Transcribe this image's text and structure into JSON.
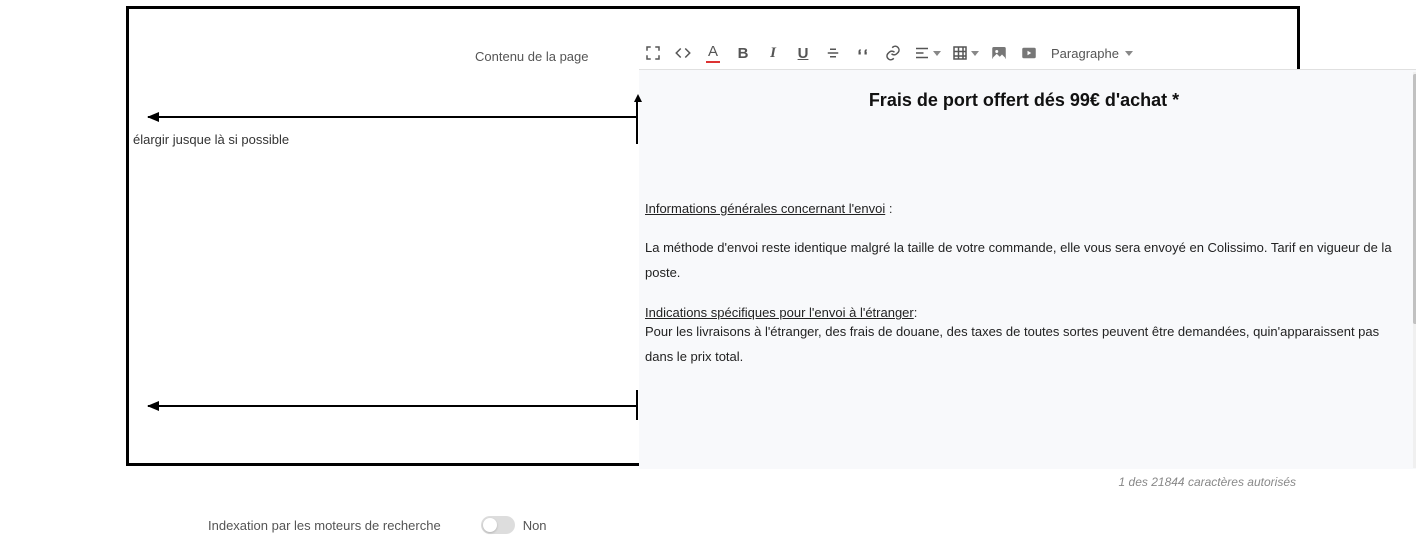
{
  "label": "Contenu de la page",
  "toolbar": {
    "paragraph_label": "Paragraphe"
  },
  "content": {
    "title": "Frais de port offert dés 99€ d'achat *",
    "section1_label": "Informations générales concernant l'envoi",
    "para1": "La méthode d'envoi reste identique malgré la taille de votre commande, elle vous sera envoyé en Colissimo. Tarif en vigueur de la poste.",
    "section2_label": "Indications spécifiques pour l'envoi à l'étranger",
    "para2": "Pour les livraisons à l'étranger, des frais de douane, des taxes de toutes sortes peuvent être demandées, quin'apparaissent pas dans le prix total."
  },
  "annotation": "élargir jusque là si possible",
  "counter": "1 des 21844 caractères autorisés",
  "index": {
    "label": "Indexation par les moteurs de recherche",
    "value": "Non"
  }
}
